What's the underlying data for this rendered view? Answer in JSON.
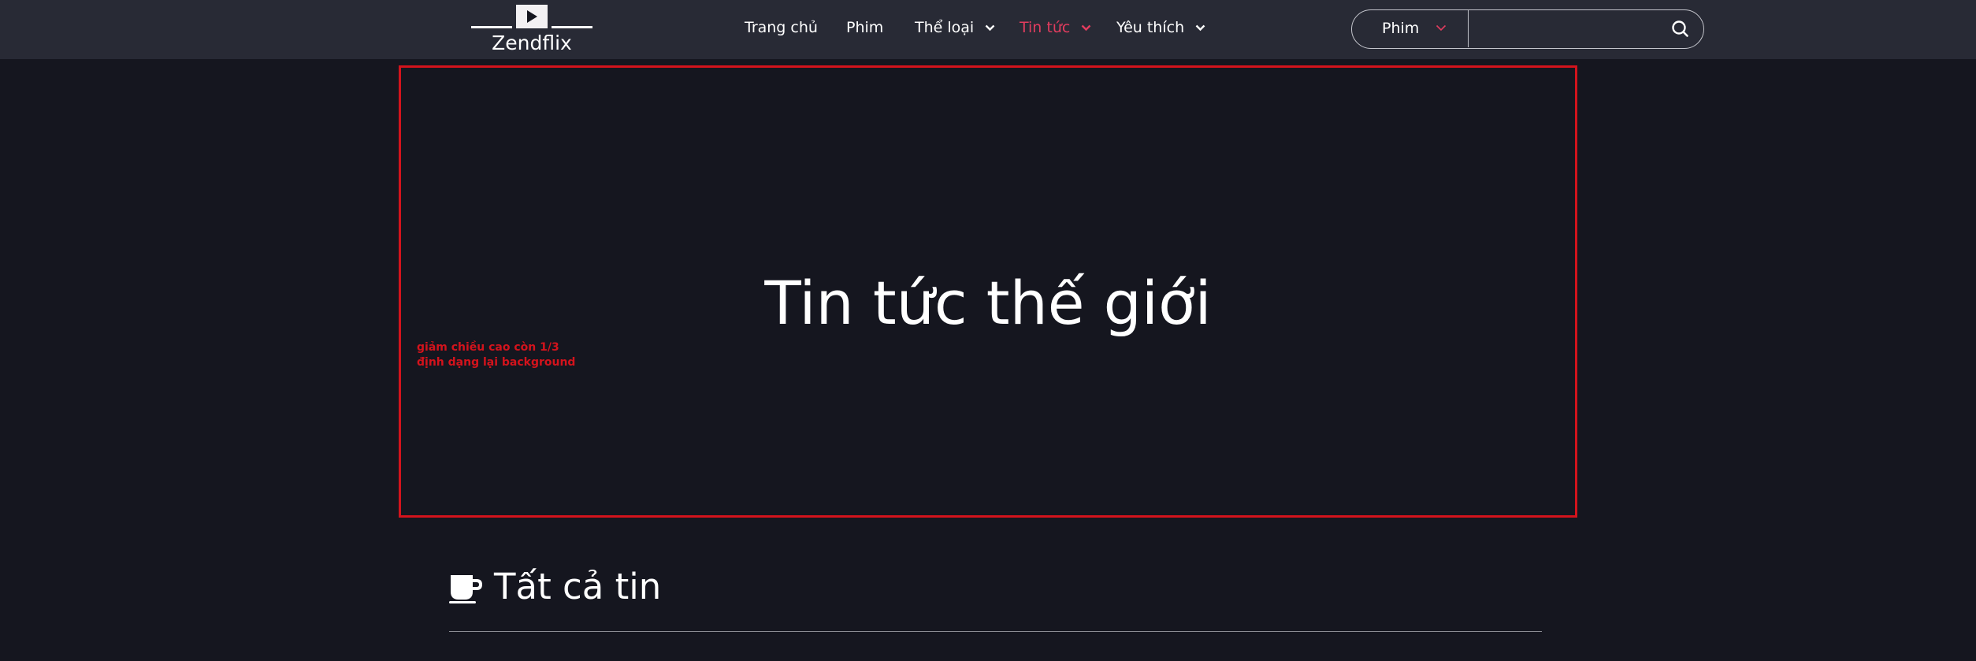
{
  "brand": {
    "name": "Zendflix"
  },
  "nav": {
    "items": [
      {
        "label": "Trang chủ",
        "has_dropdown": false,
        "active": false
      },
      {
        "label": "Phim",
        "has_dropdown": false,
        "active": false
      },
      {
        "label": "Thể loại",
        "has_dropdown": true,
        "active": false
      },
      {
        "label": "Tin tức",
        "has_dropdown": true,
        "active": true
      },
      {
        "label": "Yêu thích",
        "has_dropdown": true,
        "active": false
      }
    ]
  },
  "search": {
    "category_selected": "Phim",
    "query": "",
    "placeholder": ""
  },
  "hero": {
    "title": "Tin tức thế giới",
    "annotation_line1": "giảm chiều cao còn 1/3",
    "annotation_line2": "định dạng lại background"
  },
  "section": {
    "title": "Tất cả tin"
  },
  "colors": {
    "background": "#15161f",
    "header": "#282a35",
    "accent": "#e23c5e",
    "annotation": "#d3131c"
  }
}
